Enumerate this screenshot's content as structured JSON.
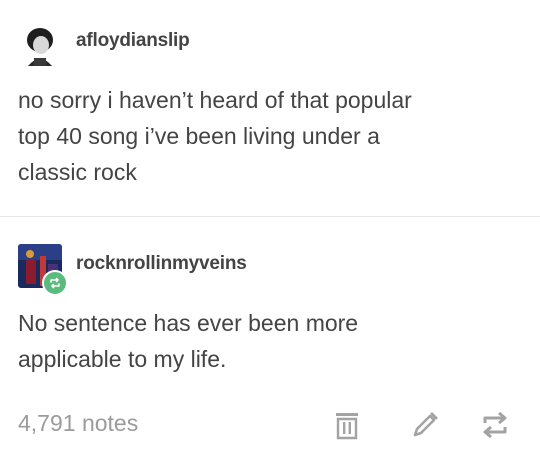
{
  "original_post": {
    "username": "afloydianslip",
    "avatar_icon": "user-avatar-photo",
    "text": "no sorry i haven’t heard of that popular\ntop 40 song i’ve been living under a\nclassic rock"
  },
  "reblog_post": {
    "username": "rocknrollinmyveins",
    "avatar_icon": "user-avatar-photo",
    "badge_icon": "reblog-icon",
    "text": "No sentence has ever been more\napplicable to my life."
  },
  "footer": {
    "notes": "4,791 notes",
    "actions": [
      {
        "name": "delete",
        "icon": "trash-icon"
      },
      {
        "name": "edit",
        "icon": "pencil-icon"
      },
      {
        "name": "reblog",
        "icon": "reblog-icon"
      }
    ]
  },
  "colors": {
    "text": "#444444",
    "muted": "#9b9b9b",
    "divider": "#e6e6e6",
    "reblog_green": "#5bba7d"
  }
}
